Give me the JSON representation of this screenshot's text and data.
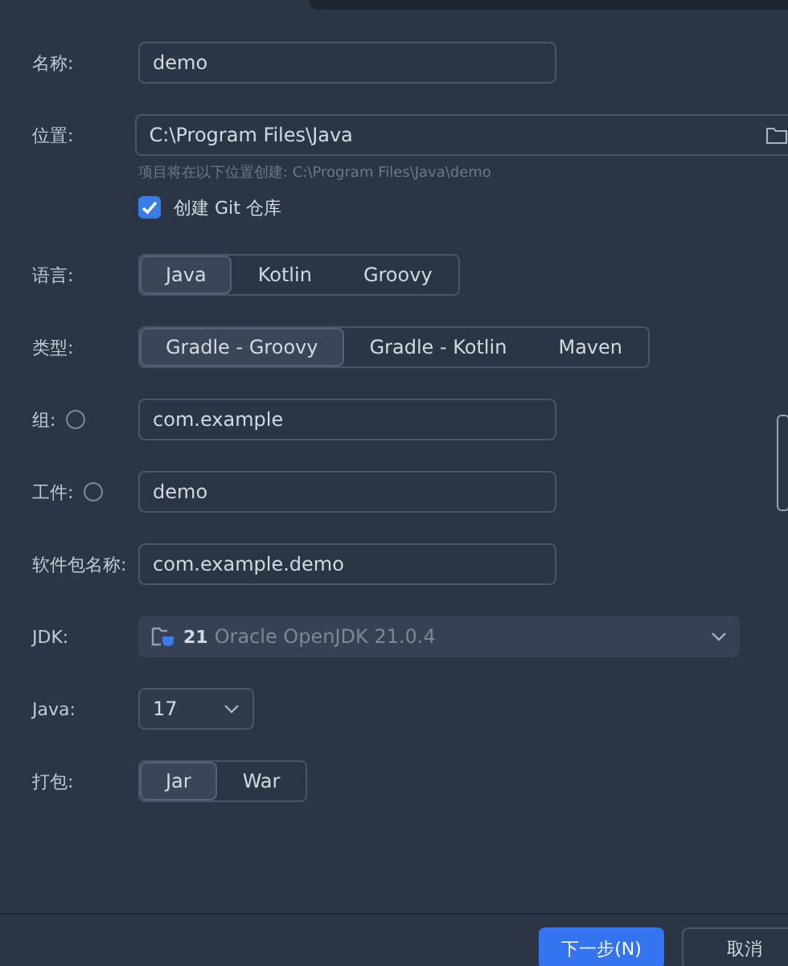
{
  "form": {
    "name": {
      "label": "名称:",
      "value": "demo"
    },
    "location": {
      "label": "位置:",
      "value": "C:\\Program Files\\Java",
      "hint": "项目将在以下位置创建: C:\\Program Files\\Java\\demo"
    },
    "git": {
      "label": "创建 Git 仓库",
      "checked": true
    },
    "language": {
      "label": "语言:",
      "options": [
        {
          "label": "Java",
          "selected": true
        },
        {
          "label": "Kotlin",
          "selected": false
        },
        {
          "label": "Groovy",
          "selected": false
        }
      ]
    },
    "type": {
      "label": "类型:",
      "options": [
        {
          "label": "Gradle - Groovy",
          "selected": true
        },
        {
          "label": "Gradle - Kotlin",
          "selected": false
        },
        {
          "label": "Maven",
          "selected": false
        }
      ]
    },
    "group": {
      "label": "组:",
      "value": "com.example"
    },
    "artifact": {
      "label": "工件:",
      "value": "demo"
    },
    "package": {
      "label": "软件包名称:",
      "value": "com.example.demo"
    },
    "jdk": {
      "label": "JDK:",
      "version": "21",
      "name": "Oracle OpenJDK 21.0.4"
    },
    "java": {
      "label": "Java:",
      "value": "17"
    },
    "packaging": {
      "label": "打包:",
      "options": [
        {
          "label": "Jar",
          "selected": true
        },
        {
          "label": "War",
          "selected": false
        }
      ]
    }
  },
  "buttons": [
    {
      "label": "下一步(N)",
      "kind": "primary"
    },
    {
      "label": "取消",
      "kind": "secondary"
    }
  ]
}
